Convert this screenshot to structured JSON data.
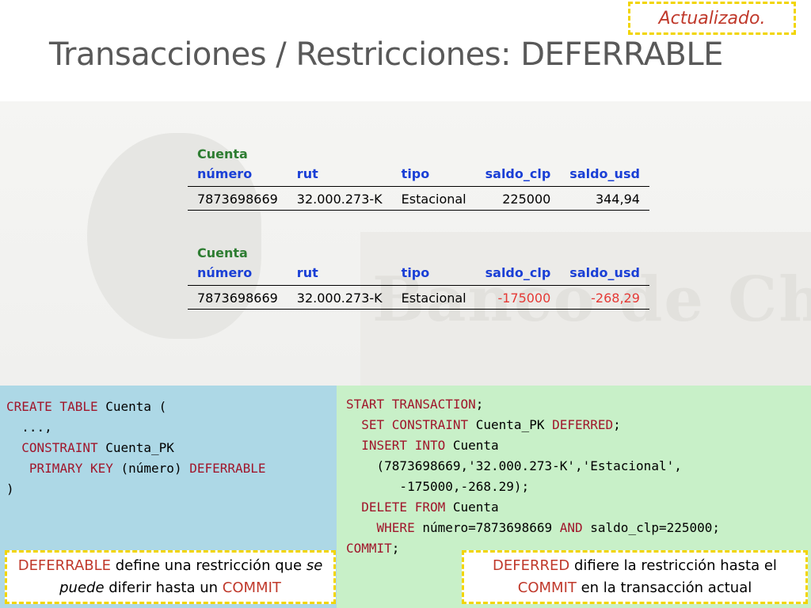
{
  "badge": "Actualizado.",
  "title": "Transacciones / Restricciones: DEFERRABLE",
  "watermark": "Banco de Chilly",
  "table_before": {
    "caption": "Cuenta",
    "headers": [
      "número",
      "rut",
      "tipo",
      "saldo_clp",
      "saldo_usd"
    ],
    "row": [
      "7873698669",
      "32.000.273-K",
      "Estacional",
      "225000",
      "344,94"
    ]
  },
  "table_after": {
    "caption": "Cuenta",
    "headers": [
      "número",
      "rut",
      "tipo",
      "saldo_clp",
      "saldo_usd"
    ],
    "row": [
      "7873698669",
      "32.000.273-K",
      "Estacional",
      "-175000",
      "-268,29"
    ]
  },
  "code_left": {
    "l1_kw": "CREATE TABLE",
    "l1_rest": " Cuenta (",
    "l2": "  ...,",
    "l3_kw": "CONSTRAINT",
    "l3_rest": " Cuenta_PK",
    "l4_kw1": "PRIMARY KEY",
    "l4_mid": " (número) ",
    "l4_kw2": "DEFERRABLE",
    "l5": ")"
  },
  "code_right": {
    "l1_kw": "START TRANSACTION",
    "l1_rest": ";",
    "l2_kw1": "SET CONSTRAINT",
    "l2_mid": " Cuenta_PK ",
    "l2_kw2": "DEFERRED",
    "l2_rest": ";",
    "l3_kw": "INSERT INTO",
    "l3_rest": " Cuenta",
    "l4": "    (7873698669,'32.000.273-K','Estacional',",
    "l5": "       -175000,-268.29);",
    "l6_kw": "DELETE FROM",
    "l6_rest": " Cuenta",
    "l7_kw1": "WHERE",
    "l7_mid": " número=7873698669 ",
    "l7_kw2": "AND",
    "l7_rest": " saldo_clp=225000;",
    "l8_kw": "COMMIT",
    "l8_rest": ";"
  },
  "note_left": {
    "kw1": "DEFERRABLE",
    "t1": " define una restricción que ",
    "it1": "se",
    "it2": "puede",
    "t2": " diferir hasta un ",
    "kw2": "COMMIT"
  },
  "note_right": {
    "kw1": "DEFERRED",
    "t1": " difiere la restricción hasta el",
    "kw2": "COMMIT",
    "t2": " en la transacción actual"
  }
}
